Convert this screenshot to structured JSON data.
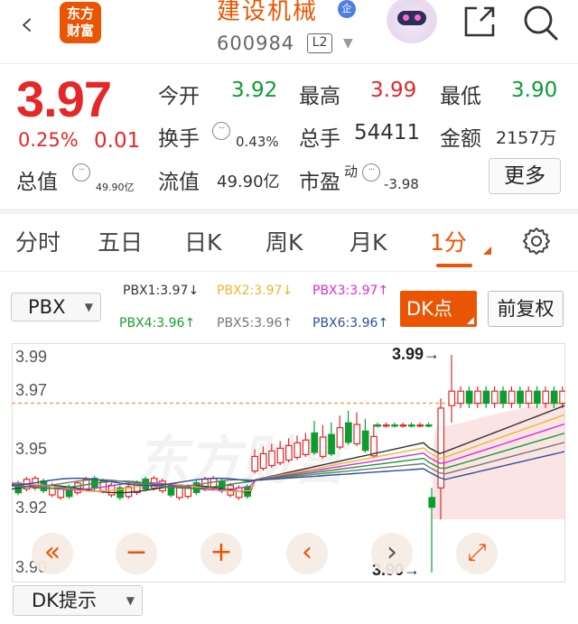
{
  "header": {
    "logo_line1": "东方",
    "logo_line2": "财富",
    "stock_name": "建设机械",
    "ent_badge": "企",
    "stock_code": "600984",
    "level_badge": "L2"
  },
  "quote": {
    "price": "3.97",
    "change_pct": "0.25%",
    "change": "0.01",
    "rows": {
      "open_label": "今开",
      "open": "3.92",
      "high_label": "最高",
      "high": "3.99",
      "low_label": "最低",
      "low": "3.90",
      "turnover_label": "换手",
      "turnover": "0.43%",
      "volume_label": "总手",
      "volume": "54411",
      "amount_label": "金额",
      "amount": "2157万",
      "mktcap_label": "总值",
      "mktcap": "49.90亿",
      "float_label": "流值",
      "float": "49.90亿",
      "pe_label": "市盈",
      "pe_sup": "动",
      "pe": "-3.98"
    },
    "more_label": "更多"
  },
  "tabs": {
    "items": [
      "分时",
      "五日",
      "日K",
      "周K",
      "月K",
      "1分"
    ],
    "active_index": 5
  },
  "indicators": {
    "selector": "PBX",
    "pbx": [
      {
        "label": "PBX1:3.97",
        "arrow": "↓",
        "color": "#333333"
      },
      {
        "label": "PBX2:3.97",
        "arrow": "↓",
        "color": "#f2b430"
      },
      {
        "label": "PBX3:3.97",
        "arrow": "↑",
        "color": "#e02ad8"
      },
      {
        "label": "PBX4:3.96",
        "arrow": "↑",
        "color": "#14a02a"
      },
      {
        "label": "PBX5:3.96",
        "arrow": "↑",
        "color": "#777777"
      },
      {
        "label": "PBX6:3.96",
        "arrow": "↑",
        "color": "#2c4f9e"
      }
    ],
    "dk_button": "DK点",
    "fq_button": "前复权"
  },
  "chart_data": {
    "type": "candlestick",
    "y_ticks": [
      "3.99",
      "3.97",
      "3.95",
      "3.92",
      "3.90"
    ],
    "ylim": [
      3.9,
      3.99
    ],
    "reference_line": 3.97,
    "high_marker": "3.99→",
    "low_marker": "3.90→",
    "colors": {
      "up": "#e42828",
      "down": "#0a9e30",
      "ref": "#f0a060"
    }
  },
  "controls": [
    "«",
    "−",
    "+",
    "‹",
    "›",
    "⤢"
  ],
  "dk_tip": "DK提示"
}
